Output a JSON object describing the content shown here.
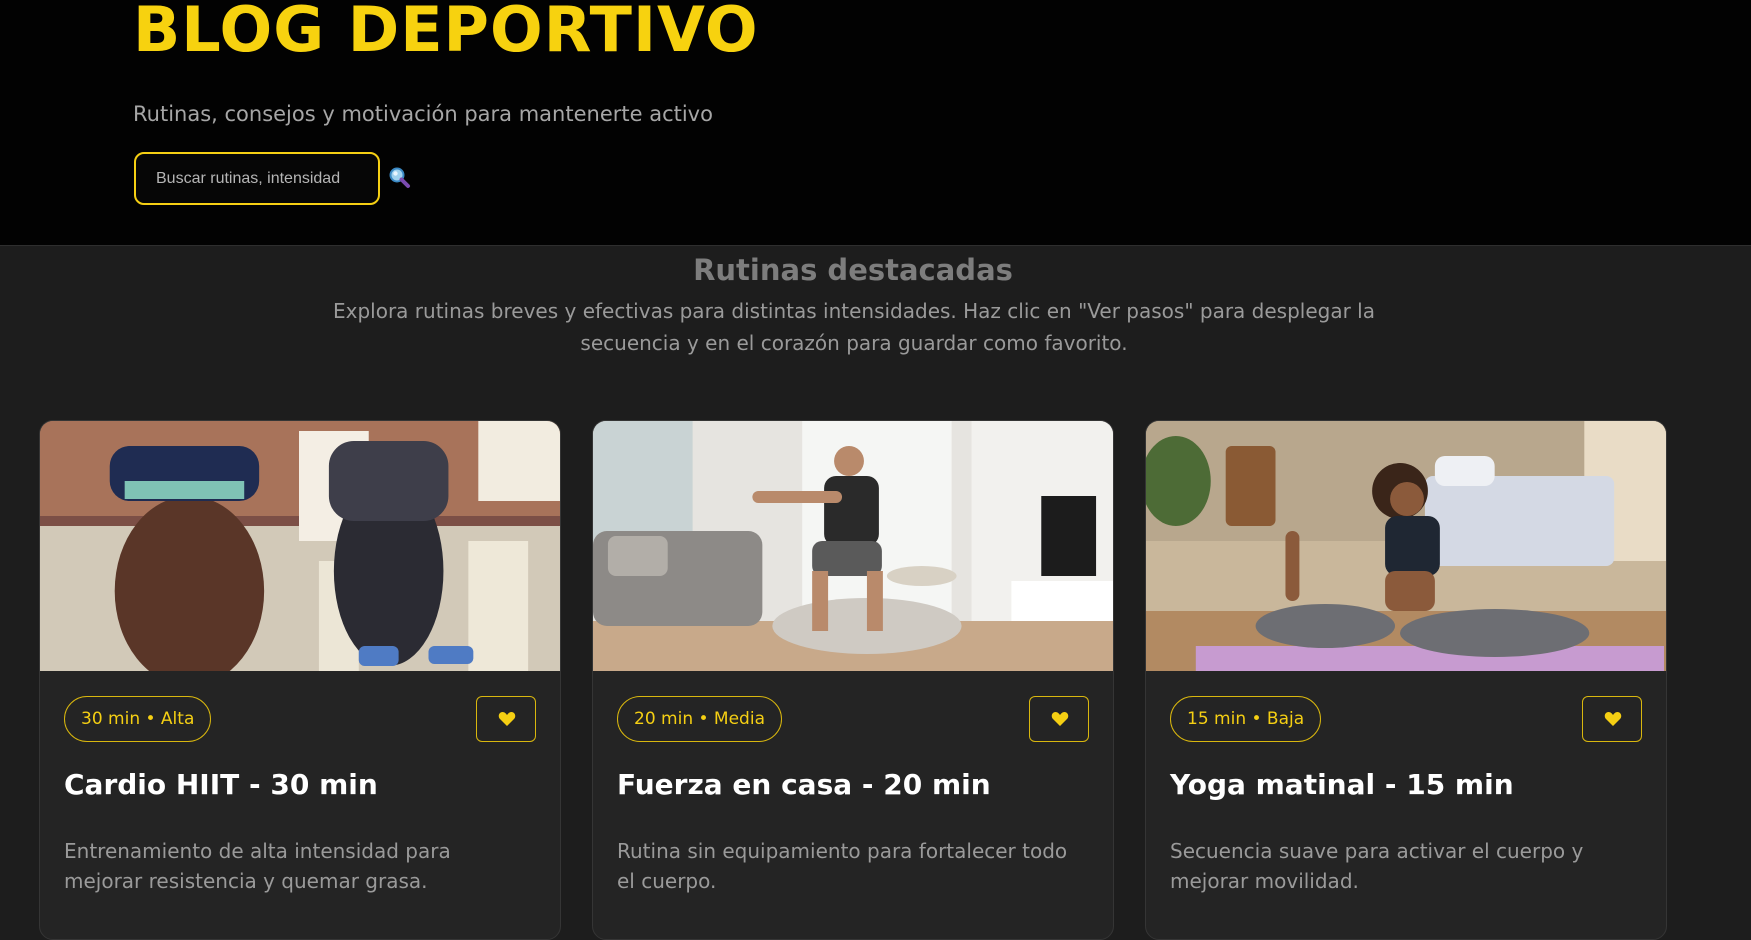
{
  "header": {
    "title": "BLOG DEPORTIVO",
    "tagline": "Rutinas, consejos y motivación para mantenerte activo",
    "search": {
      "placeholder": "Buscar rutinas, intensidad",
      "value": "",
      "icon": "magnifying-glass-icon"
    }
  },
  "featured": {
    "title": "Rutinas destacadas",
    "description": "Explora rutinas breves y efectivas para distintas intensidades. Haz clic en \"Ver pasos\" para desplegar la secuencia y en el corazón para guardar como favorito."
  },
  "cards": [
    {
      "badge": "30 min • Alta",
      "title": "Cardio HIIT - 30 min",
      "description": "Entrenamiento de alta intensidad para mejorar resistencia y quemar grasa.",
      "favorite_icon": "heart-icon"
    },
    {
      "badge": "20 min • Media",
      "title": "Fuerza en casa - 20 min",
      "description": "Rutina sin equipamiento para fortalecer todo el cuerpo.",
      "favorite_icon": "heart-icon"
    },
    {
      "badge": "15 min • Baja",
      "title": "Yoga matinal - 15 min",
      "description": "Secuencia suave para activar el cuerpo y mejorar movilidad.",
      "favorite_icon": "heart-icon"
    }
  ],
  "colors": {
    "accent": "#f5cf13",
    "header_bg": "#020202",
    "page_bg": "#1d1d1d",
    "card_bg": "#242424"
  }
}
